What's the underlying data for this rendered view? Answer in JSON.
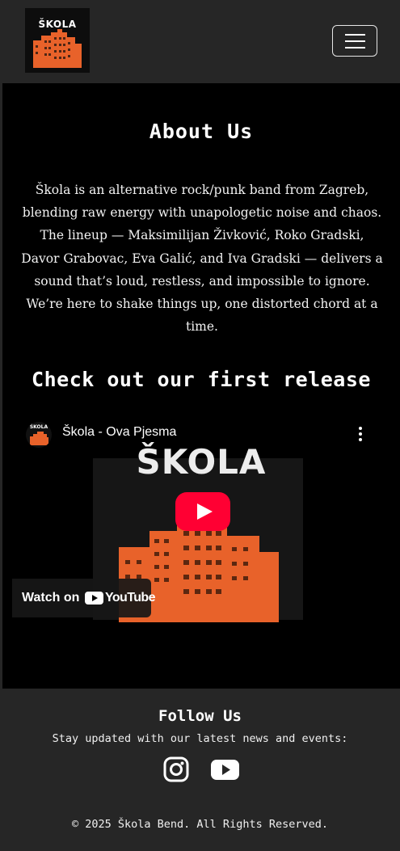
{
  "brand": {
    "logo_text": "ŠKOLA"
  },
  "navbar": {
    "menu_icon": "hamburger-menu-icon"
  },
  "about": {
    "title": "About Us",
    "text": "Škola is an alternative rock/punk band from Zagreb, blending raw energy with unapologetic noise and chaos. The lineup — Maksimilijan Živković, Roko Gradski, Davor Grabovac, Eva Galić, and Iva Gradski — delivers a sound that’s loud, restless, and impossible to ignore. We’re here to shake things up, one distorted chord at a time."
  },
  "release": {
    "title": "Check out our first release"
  },
  "video": {
    "channel_avatar_text": "ŠKOLA",
    "title": "Škola - Ova Pjesma",
    "cover_title": "ŠKOLA",
    "watch_on_label": "Watch on",
    "youtube_wordmark": "YouTube",
    "play_icon": "play-icon",
    "more_icon": "more-vert-icon"
  },
  "footer": {
    "follow_title": "Follow Us",
    "follow_subtitle": "Stay updated with our latest news and events:",
    "social": [
      {
        "icon": "instagram-icon"
      },
      {
        "icon": "youtube-icon"
      }
    ],
    "copyright": "© 2025 Škola Bend. All Rights Reserved."
  },
  "colors": {
    "background_dark": "#262626",
    "main_background": "#000000",
    "accent_orange": "#e8622a",
    "youtube_red": "#ff0033"
  }
}
